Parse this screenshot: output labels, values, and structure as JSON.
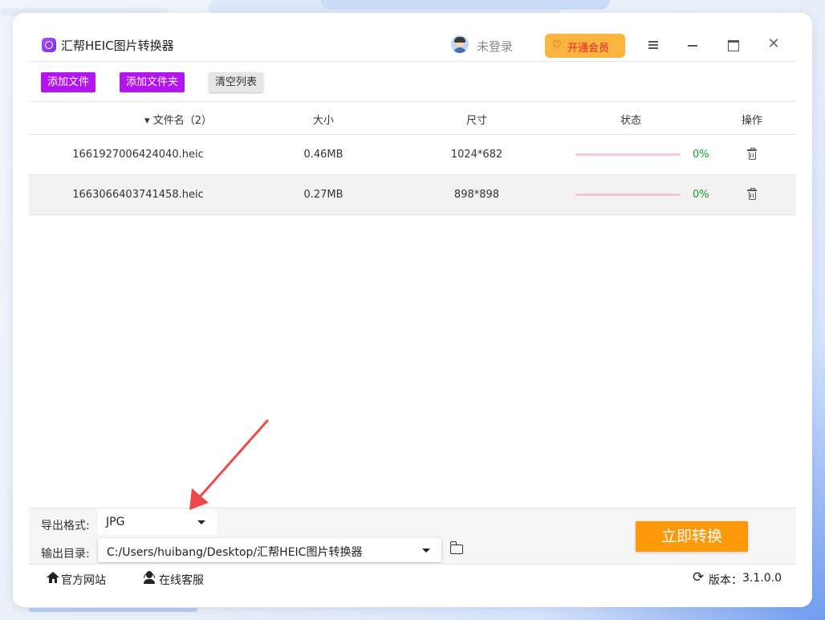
{
  "app": {
    "title": "汇帮HEIC图片转换器",
    "login_label": "未登录",
    "vip_label": "开通会员",
    "icons": [
      "app-logo-icon",
      "avatar-icon",
      "diamond-icon",
      "menu-icon",
      "minimize-icon",
      "maximize-icon",
      "close-icon"
    ]
  },
  "toolbar": {
    "add_file": "添加文件",
    "add_folder": "添加文件夹",
    "clear_list": "清空列表"
  },
  "table": {
    "columns": {
      "filename": "▾ 文件名（2）",
      "size": "大小",
      "dimensions": "尺寸",
      "status": "状态",
      "action": "操作"
    },
    "rows": [
      {
        "filename": "1661927006424040.heic",
        "size": "0.46MB",
        "dimensions": "1024*682",
        "progress": "0%"
      },
      {
        "filename": "1663066403741458.heic",
        "size": "0.27MB",
        "dimensions": "898*898",
        "progress": "0%"
      }
    ]
  },
  "settings": {
    "format_label": "导出格式:",
    "format_value": "JPG",
    "output_label": "输出目录:",
    "output_value": "C:/Users/huibang/Desktop/汇帮HEIC图片转换器",
    "convert_button": "立即转换"
  },
  "footer": {
    "website": "官方网站",
    "support": "在线客服",
    "version_label": "版本：",
    "version": "3.1.0.0"
  },
  "colors": {
    "purple_button": "#b414f0",
    "vip_button": "#fbb43f",
    "convert_button": "#fe9a0a",
    "progress_track": "#f7c6d6",
    "percent_text": "#1a9a2a",
    "annotation_arrow": "#ec4a4a"
  }
}
